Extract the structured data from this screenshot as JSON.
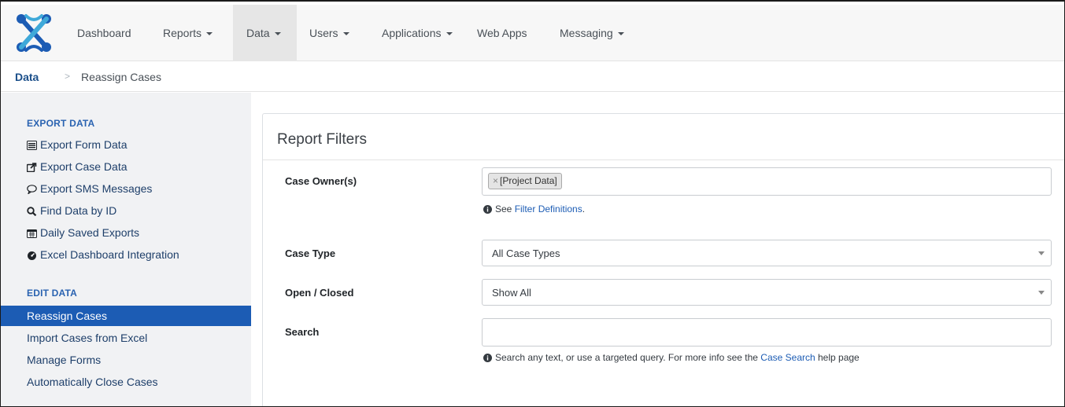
{
  "navbar": {
    "logo_icon": "commcare-logo-icon",
    "items": [
      {
        "label": "Dashboard",
        "has_caret": false
      },
      {
        "label": "Reports",
        "has_caret": true
      },
      {
        "label": "Data",
        "has_caret": true,
        "active": true
      },
      {
        "label": "Users",
        "has_caret": true
      },
      {
        "label": "Applications",
        "has_caret": true
      },
      {
        "label": "Web Apps",
        "has_caret": false
      },
      {
        "label": "Messaging",
        "has_caret": true
      }
    ]
  },
  "breadcrumb": {
    "root": "Data",
    "separator": ">",
    "current": "Reassign Cases"
  },
  "sidebar": {
    "export_heading": "EXPORT DATA",
    "export_items": [
      {
        "label": "Export Form Data",
        "icon": "list-alt-icon"
      },
      {
        "label": "Export Case Data",
        "icon": "share-square-icon"
      },
      {
        "label": "Export SMS Messages",
        "icon": "comment-icon"
      },
      {
        "label": "Find Data by ID",
        "icon": "search-icon"
      },
      {
        "label": "Daily Saved Exports",
        "icon": "calendar-icon"
      },
      {
        "label": "Excel Dashboard Integration",
        "icon": "dashboard-gauge-icon"
      }
    ],
    "edit_heading": "EDIT DATA",
    "edit_items": [
      {
        "label": "Reassign Cases",
        "active": true
      },
      {
        "label": "Import Cases from Excel"
      },
      {
        "label": "Manage Forms"
      },
      {
        "label": "Automatically Close Cases"
      }
    ]
  },
  "filters": {
    "title": "Report Filters",
    "case_owner": {
      "label": "Case Owner(s)",
      "tag_remove": "×",
      "tag": "[Project Data]",
      "help_prefix": "See ",
      "help_link": "Filter Definitions",
      "help_suffix": "."
    },
    "case_type": {
      "label": "Case Type",
      "value": "All Case Types"
    },
    "open_closed": {
      "label": "Open / Closed",
      "value": "Show All"
    },
    "search": {
      "label": "Search",
      "value": "",
      "help_prefix": "Search any text, or use a targeted query. For more info see the ",
      "help_link": "Case Search",
      "help_suffix": " help page"
    }
  },
  "colors": {
    "brand_blue": "#1c5cb4",
    "navbar_bg": "#f7f7f7",
    "sidebar_bg": "#f1f2f4",
    "link_blue": "#1e3f6a"
  }
}
